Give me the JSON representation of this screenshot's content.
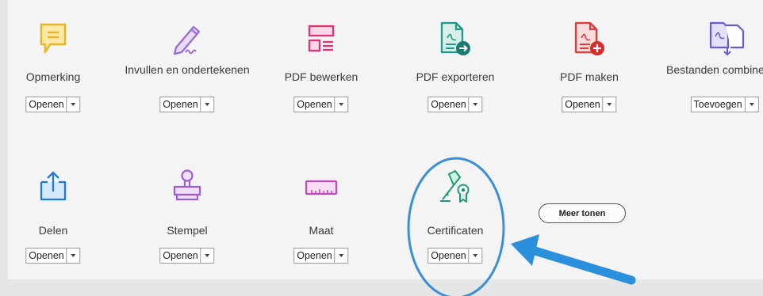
{
  "tools": [
    {
      "label": "Opmerking",
      "action": "Openen",
      "icon": "comment-icon"
    },
    {
      "label": "Invullen en ondertekenen",
      "action": "Openen",
      "icon": "fill-sign-icon"
    },
    {
      "label": "PDF bewerken",
      "action": "Openen",
      "icon": "edit-pdf-icon"
    },
    {
      "label": "PDF exporteren",
      "action": "Openen",
      "icon": "export-pdf-icon"
    },
    {
      "label": "PDF maken",
      "action": "Openen",
      "icon": "create-pdf-icon"
    },
    {
      "label": "Bestanden combineren",
      "action": "Toevoegen",
      "icon": "combine-files-icon"
    },
    {
      "label": "Delen",
      "action": "Openen",
      "icon": "share-icon"
    },
    {
      "label": "Stempel",
      "action": "Openen",
      "icon": "stamp-icon"
    },
    {
      "label": "Maat",
      "action": "Openen",
      "icon": "measure-icon"
    },
    {
      "label": "Certificaten",
      "action": "Openen",
      "icon": "certificates-icon"
    }
  ],
  "more_tools_label": "Meer tonen",
  "colors": {
    "highlight": "#3a8fd6",
    "arrow": "#2b8fdb",
    "comment": "#e5b52a",
    "fill_sign": "#9b6cd6",
    "edit": "#e0337a",
    "export": "#1e9a8a",
    "create": "#e03a3a",
    "combine": "#6a5ad8",
    "share": "#1f7ad8",
    "stamp": "#a05cd2",
    "measure": "#c04ab8",
    "certificates": "#1f9a78"
  }
}
